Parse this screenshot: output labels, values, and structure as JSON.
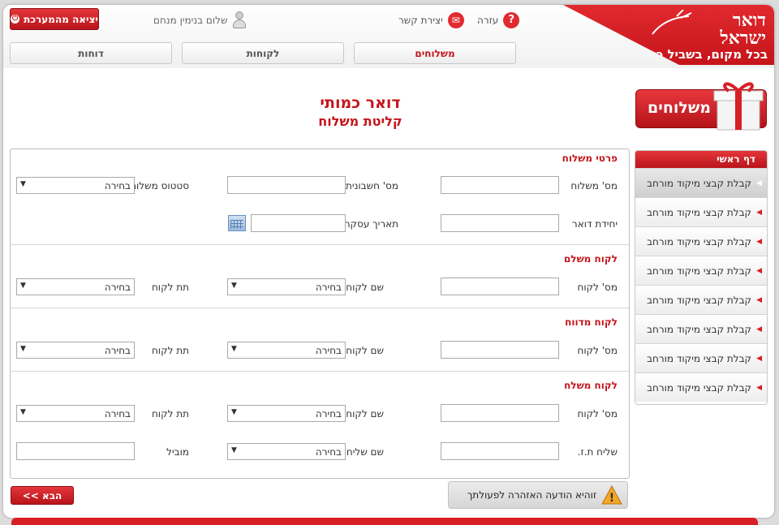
{
  "header": {
    "logout_label": "יציאה מהמערכת",
    "greeting": "שלום בנימין מנחם",
    "contact_label": "יצירת קשר",
    "help_label": "עזרה",
    "logo_name_line1": "דואר",
    "logo_name_line2": "ישראל",
    "logo_slogan": "בכל מקום, בשביל כולם"
  },
  "tabs": [
    {
      "label": "משלוחים",
      "active": true
    },
    {
      "label": "לקוחות",
      "active": false
    },
    {
      "label": "דוחות",
      "active": false
    }
  ],
  "page": {
    "title": "דואר כמותי",
    "subtitle": "קליטת משלוח"
  },
  "form": {
    "section_shipment": "פרטי משלוח",
    "shipment_no_label": "מס' משלוח",
    "account_no_label": "מס' חשבונית",
    "status_label": "סטטוס משלוח",
    "status_value": "בחירה",
    "postal_unit_label": "יחידת דואר",
    "deal_date_label": "תאריך עסקה",
    "section_payer": "לקוח משלם",
    "section_reporter": "לקוח מדווח",
    "section_sender": "לקוח משלח",
    "customer_no_label": "מס' לקוח",
    "customer_name_label": "שם לקוח",
    "sub_customer_label": "תת לקוח",
    "select_value": "בחירה",
    "courier_id_label": "שליח ת.ז.",
    "courier_name_label": "שם שליח",
    "carrier_label": "מוביל"
  },
  "buttons": {
    "next_label": "הבא >>",
    "warning_label": "זוהיא הודעה האזהרה לפעולתך"
  },
  "sidebar": {
    "banner_label": "משלוחים",
    "menu_head": "דף ראשי",
    "items": [
      {
        "label": "קבלת קבצי מיקוד מורחב"
      },
      {
        "label": "קבלת קבצי מיקוד מורחב"
      },
      {
        "label": "קבלת קבצי מיקוד מורחב"
      },
      {
        "label": "קבלת קבצי מיקוד מורחב"
      },
      {
        "label": "קבלת קבצי מיקוד מורחב"
      },
      {
        "label": "קבלת קבצי מיקוד מורחב"
      },
      {
        "label": "קבלת קבצי מיקוד מורחב"
      },
      {
        "label": "קבלת קבצי מיקוד מורחב"
      }
    ]
  },
  "colors": {
    "brand_red": "#d91f26",
    "title_red": "#c5141a"
  }
}
